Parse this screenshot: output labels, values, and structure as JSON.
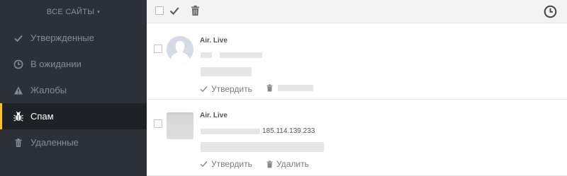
{
  "sidebar": {
    "site_select": {
      "label": "ВСЕ САЙТЫ",
      "caret": "▾"
    },
    "items": [
      {
        "label": "Утвержденные",
        "icon": "check-icon"
      },
      {
        "label": "В ожидании",
        "icon": "clock-icon"
      },
      {
        "label": "Жалобы",
        "icon": "warning-icon"
      },
      {
        "label": "Спам",
        "icon": "bug-icon",
        "active": true
      },
      {
        "label": "Удаленные",
        "icon": "trash-icon"
      }
    ],
    "colors": {
      "background": "#2c3138",
      "active_background": "#1e2227",
      "active_accent": "#f5c32c"
    }
  },
  "toolbar": {
    "icons": [
      "select-all-checkbox",
      "check-icon",
      "trash-icon",
      "clock-icon"
    ]
  },
  "comments": [
    {
      "author": "Air. Live",
      "avatar": "default-user-avatar",
      "approve_label": "Утвердить",
      "delete_label": ""
    },
    {
      "author": "Air. Live",
      "avatar": "image-avatar",
      "ip": "185.114.139.233",
      "approve_label": "Утвердить",
      "delete_label": "Удалить"
    }
  ]
}
